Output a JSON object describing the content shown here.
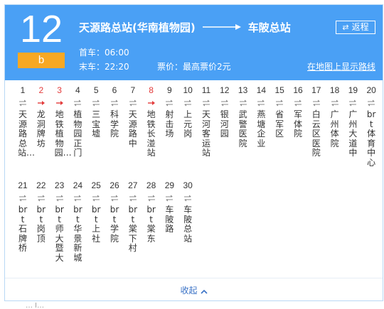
{
  "header": {
    "route_number": "12",
    "route_sub": "b",
    "origin": "天源路总站(华南植物园)",
    "destination": "车陂总站",
    "return_label": "返程",
    "first_bus": "首车：06:00",
    "last_bus": "末车：22:20",
    "fare": "票价：最高票价2元",
    "map_link": "在地图上显示路线"
  },
  "colors": {
    "header_bg": "#4aa0f5",
    "badge": "#f7a823",
    "transfer_red": "#e33b3b",
    "link_blue": "#3a72c6"
  },
  "stops_row1": [
    {
      "num": "1",
      "name": "天源路总站…",
      "highlight": false
    },
    {
      "num": "2",
      "name": "龙洞牌坊",
      "highlight": true
    },
    {
      "num": "3",
      "name": "地铁植物园…",
      "highlight": true
    },
    {
      "num": "4",
      "name": "植物园正门",
      "highlight": false
    },
    {
      "num": "5",
      "name": "三宝墟",
      "highlight": false
    },
    {
      "num": "6",
      "name": "科学院",
      "highlight": false
    },
    {
      "num": "7",
      "name": "天源路中",
      "highlight": false
    },
    {
      "num": "8",
      "name": "地铁长湴站",
      "highlight": true
    },
    {
      "num": "9",
      "name": "射击场",
      "highlight": false
    },
    {
      "num": "10",
      "name": "上元岗",
      "highlight": false
    },
    {
      "num": "11",
      "name": "天河客运站",
      "highlight": false
    },
    {
      "num": "12",
      "name": "银河园",
      "highlight": false
    },
    {
      "num": "13",
      "name": "武警医院",
      "highlight": false
    },
    {
      "num": "14",
      "name": "燕塘企业",
      "highlight": false
    },
    {
      "num": "15",
      "name": "省军区",
      "highlight": false
    },
    {
      "num": "16",
      "name": "军体院",
      "highlight": false
    },
    {
      "num": "17",
      "name": "白云区医院",
      "highlight": false
    },
    {
      "num": "18",
      "name": "广州体院",
      "highlight": false
    },
    {
      "num": "19",
      "name": "广州大道中",
      "highlight": false
    },
    {
      "num": "20",
      "name": "brt体育中心",
      "highlight": false
    }
  ],
  "stops_row2": [
    {
      "num": "21",
      "name": "brt石牌桥",
      "highlight": false
    },
    {
      "num": "22",
      "name": "brt岗顶",
      "highlight": false
    },
    {
      "num": "23",
      "name": "brt师大暨大",
      "highlight": false
    },
    {
      "num": "24",
      "name": "brt华景新城",
      "highlight": false
    },
    {
      "num": "25",
      "name": "brt上社",
      "highlight": false
    },
    {
      "num": "26",
      "name": "brt学院",
      "highlight": false
    },
    {
      "num": "27",
      "name": "brt棠下村",
      "highlight": false
    },
    {
      "num": "28",
      "name": "brt棠东",
      "highlight": false
    },
    {
      "num": "29",
      "name": "车陂路",
      "highlight": false
    },
    {
      "num": "30",
      "name": "车陂总站",
      "highlight": false
    }
  ],
  "footer": {
    "collapse_label": "收起"
  },
  "tail_text": "… l…"
}
